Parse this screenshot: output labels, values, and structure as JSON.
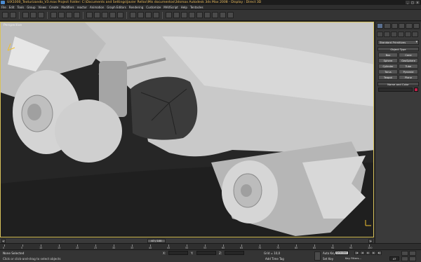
{
  "window": {
    "title": "UIX1000_Texturizando_V3.max      Project Folder: C:\\Documents and Settings\\Javier Relloc\\Mis documentos\\3dsmax      Autodesk 3ds Max 2008      - Display : Direct 3D",
    "buttons": [
      "_",
      "□",
      "✕"
    ]
  },
  "menu": [
    "File",
    "Edit",
    "Tools",
    "Group",
    "Views",
    "Create",
    "Modifiers",
    "reactor",
    "Animation",
    "Graph Editors",
    "Rendering",
    "Customize",
    "MAXScript",
    "Help",
    "Tentacles"
  ],
  "viewport": {
    "label": "Perspective",
    "border_color": "#d8c25a"
  },
  "command_panel": {
    "dropdown": "Standard Primitives",
    "object_type_header": "Object Type",
    "object_buttons": [
      "Box",
      "Cone",
      "Sphere",
      "GeoSphere",
      "Cylinder",
      "Tube",
      "Torus",
      "Pyramid",
      "Teapot",
      "Plane"
    ],
    "name_color_header": "Name and Color",
    "swatch_color": "#c0204a"
  },
  "time_slider": {
    "label": "47 / 100",
    "prev": "<",
    "next": ">"
  },
  "trackbar": {
    "ticks": [
      "0",
      "5",
      "10",
      "15",
      "20",
      "25",
      "30",
      "35",
      "40",
      "45",
      "50",
      "55",
      "60",
      "65",
      "70",
      "75",
      "80",
      "85",
      "90",
      "95",
      "100"
    ]
  },
  "status": {
    "selection": "None Selected",
    "prompt": "Click or click-and-drag to select objects",
    "x_label": "X:",
    "y_label": "Y:",
    "z_label": "Z:",
    "grid": "Grid = 10,0",
    "add_time_tag": "Add Time Tag",
    "auto_key": "Auto Key",
    "set_key": "Set Key",
    "selected_dropdown": "Selected",
    "key_filters": "Key Filters...",
    "frame": "47"
  }
}
